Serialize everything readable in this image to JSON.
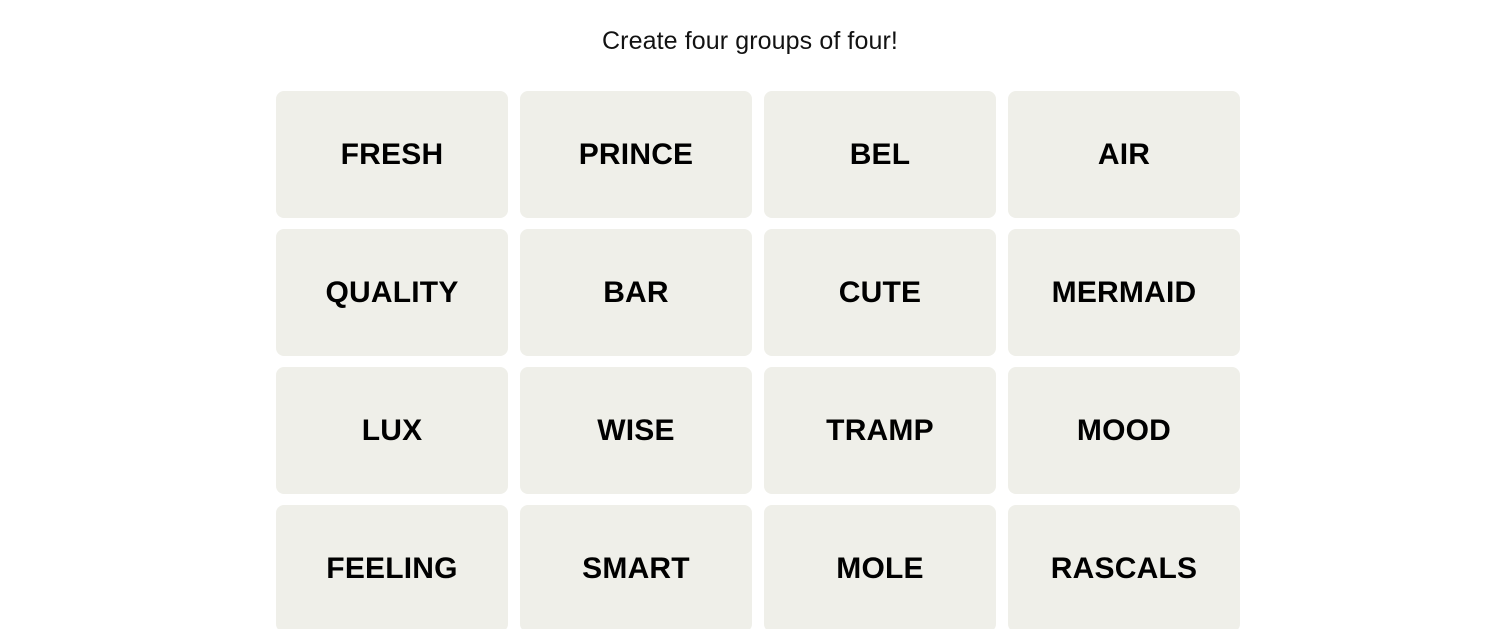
{
  "page": {
    "background_color": "#ffffff"
  },
  "header": {
    "title": "Create four groups of four!"
  },
  "board": {
    "rows": 4,
    "columns": 4,
    "tile_color": "#efefe9",
    "tile_text_color": "#000000",
    "tiles": [
      {
        "label": "FRESH"
      },
      {
        "label": "PRINCE"
      },
      {
        "label": "BEL"
      },
      {
        "label": "AIR"
      },
      {
        "label": "QUALITY"
      },
      {
        "label": "BAR"
      },
      {
        "label": "CUTE"
      },
      {
        "label": "MERMAID"
      },
      {
        "label": "LUX"
      },
      {
        "label": "WISE"
      },
      {
        "label": "TRAMP"
      },
      {
        "label": "MOOD"
      },
      {
        "label": "FEELING"
      },
      {
        "label": "SMART"
      },
      {
        "label": "MOLE"
      },
      {
        "label": "RASCALS"
      }
    ]
  }
}
